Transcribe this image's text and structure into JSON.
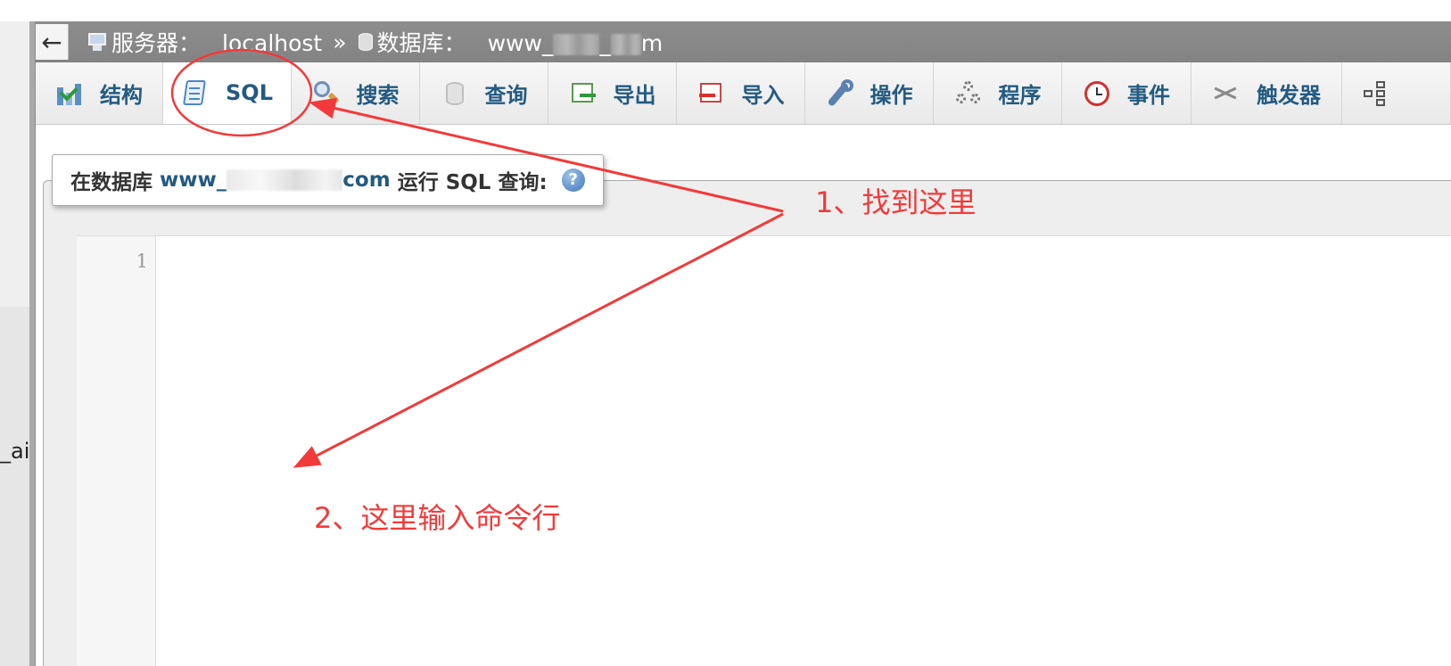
{
  "left_panel": {
    "fragment_text": "_ai"
  },
  "breadcrumb": {
    "back_label": "←",
    "server_label": "服务器：",
    "server_value": "localhost",
    "separator": "»",
    "database_label": "数据库：",
    "database_value_prefix": "www_",
    "database_value_mid": "_",
    "database_value_suffix": "m"
  },
  "tabs": [
    {
      "label": "结构",
      "icon": "structure-icon"
    },
    {
      "label": "SQL",
      "icon": "sql-icon",
      "active": true
    },
    {
      "label": "搜索",
      "icon": "search-icon"
    },
    {
      "label": "查询",
      "icon": "query-icon"
    },
    {
      "label": "导出",
      "icon": "export-icon"
    },
    {
      "label": "导入",
      "icon": "import-icon"
    },
    {
      "label": "操作",
      "icon": "wrench-icon"
    },
    {
      "label": "程序",
      "icon": "routines-icon"
    },
    {
      "label": "事件",
      "icon": "clock-icon"
    },
    {
      "label": "触发器",
      "icon": "trigger-icon"
    }
  ],
  "sql_panel": {
    "legend_prefix": "在数据库",
    "legend_db": "www_",
    "legend_db_suffix": "com",
    "legend_suffix": "运行 SQL 查询:",
    "help_glyph": "?",
    "line_numbers": [
      "1"
    ]
  },
  "annotations": {
    "step1": "1、找到这里",
    "step2": "2、这里输入命令行",
    "color": "#f23a3a"
  }
}
